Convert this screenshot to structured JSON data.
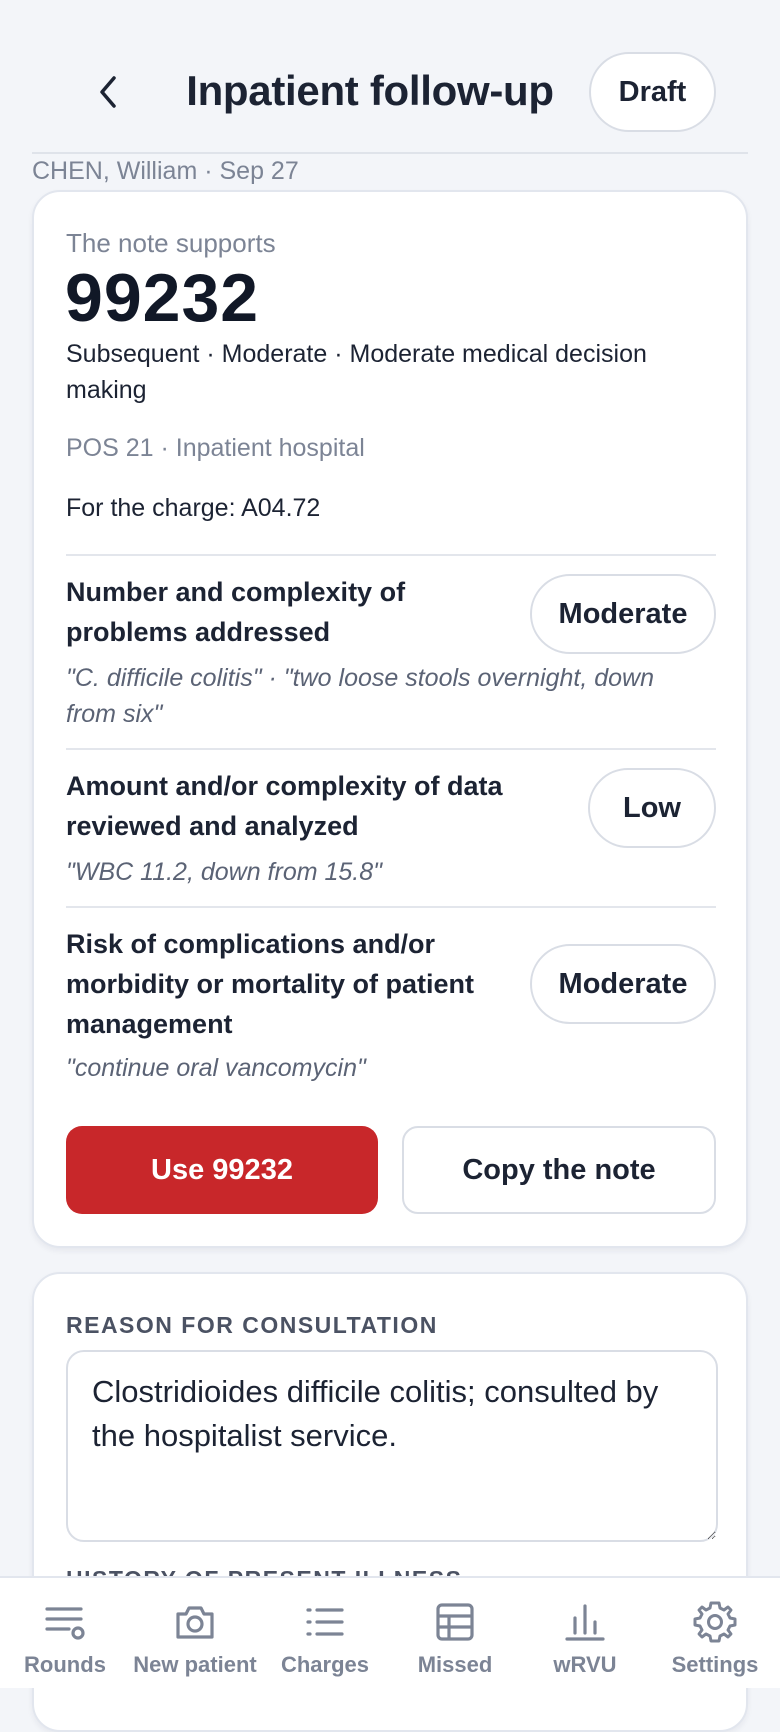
{
  "header": {
    "title": "Inpatient follow-up",
    "status_button": "Draft"
  },
  "patient": {
    "line": "CHEN, William · Sep 27"
  },
  "summary": {
    "supports_label": "The note supports",
    "code": "99232",
    "description": "Subsequent · Moderate · Moderate medical decision making",
    "pos": "POS 21 · Inpatient hospital",
    "charge": "For the charge: A04.72",
    "elements": [
      {
        "title": "Number and complexity of problems addressed",
        "level": "Moderate",
        "quote": "\"C. difficile colitis\" · \"two loose stools overnight, down from six\""
      },
      {
        "title": "Amount and/or complexity of data reviewed and analyzed",
        "level": "Low",
        "quote": "\"WBC 11.2, down from 15.8\""
      },
      {
        "title": "Risk of complications and/or morbidity or mortality of patient management",
        "level": "Moderate",
        "quote": "\"continue oral vancomycin\""
      }
    ],
    "primary_button": "Use 99232",
    "secondary_button": "Copy the note"
  },
  "reason": {
    "label": "REASON FOR CONSULTATION",
    "value": "Clostridioides difficile colitis; consulted by the hospitalist service.",
    "next_section_label": "HISTORY OF PRESENT ILLNESS"
  },
  "nav": {
    "items": [
      {
        "label": "Rounds",
        "icon": "rounds-icon"
      },
      {
        "label": "New patient",
        "icon": "camera-icon"
      },
      {
        "label": "Charges",
        "icon": "list-icon"
      },
      {
        "label": "Missed",
        "icon": "table-icon"
      },
      {
        "label": "wRVU",
        "icon": "bar-chart-icon"
      },
      {
        "label": "Settings",
        "icon": "gear-icon"
      }
    ]
  },
  "colors": {
    "accent": "#c8272a",
    "text": "#1c2333",
    "muted": "#7c8495",
    "background": "#f3f5f9"
  }
}
